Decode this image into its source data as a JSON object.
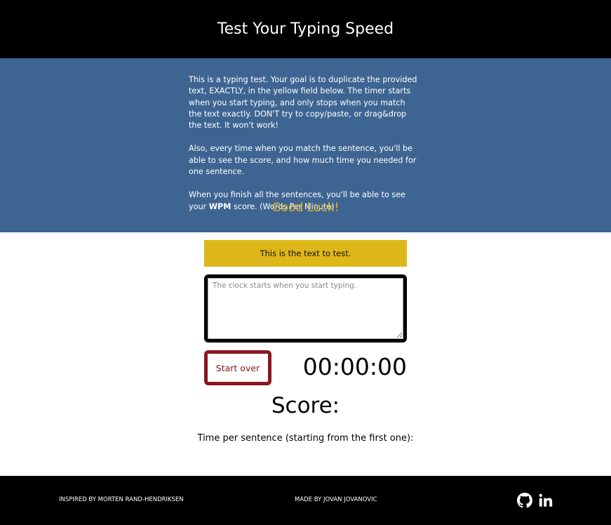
{
  "header": {
    "title": "Test Your Typing Speed"
  },
  "intro": {
    "p1": "This is a typing test. Your goal is to duplicate the provided text, EXACTLY, in the yellow field below. The timer starts when you start typing, and only stops when you match the text exactly. DON'T try to copy/paste, or drag&drop the text. It won't work!",
    "p2": "Also, every time when you match the sentence, you'll be able to see the score, and how much time you needed for one sentence.",
    "p3_before": "When you finish all the sentences, you'll be able to see your ",
    "p3_bold": "WPM",
    "p3_after": " score. (Words Per Minute)",
    "good_luck": "Good Luck!"
  },
  "test": {
    "origin_text": "This is the text to test.",
    "textarea_value": "",
    "textarea_placeholder": "The clock starts when you start typing.",
    "reset_label": "Start over",
    "timer": "00:00:00",
    "score_label": "Score:",
    "time_per_sentence_label": "Time per sentence (starting from the first one):"
  },
  "footer": {
    "inspired_by": "INSPIRED BY MORTEN RAND-HENDRIKSEN",
    "made_by": "MADE BY JOVAN JOVANOVIC",
    "icons": [
      "github-icon",
      "linkedin-icon"
    ]
  },
  "colors": {
    "header_bg": "#000000",
    "intro_bg": "#3e6592",
    "good_luck": "#e3b628",
    "origin_bg": "#ddb71a",
    "reset_border": "#8a1820",
    "footer_bg": "#000000"
  }
}
